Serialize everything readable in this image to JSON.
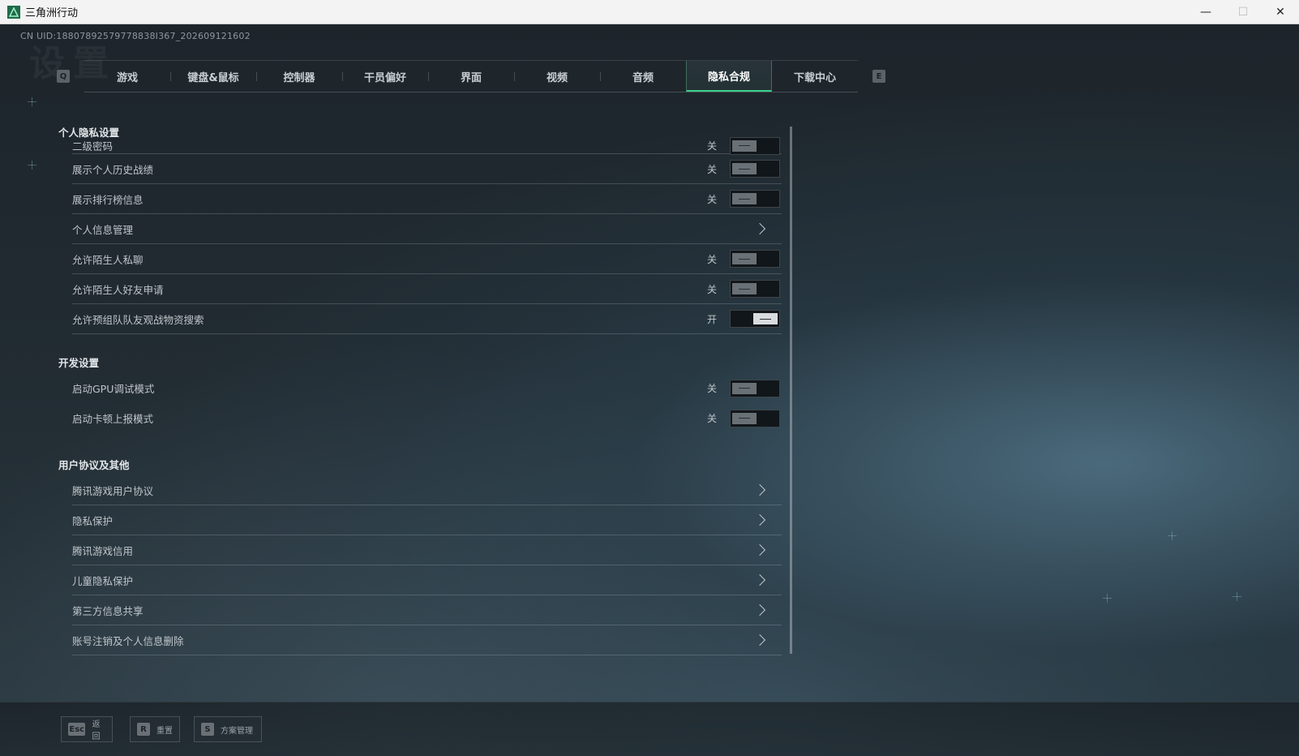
{
  "window": {
    "title": "三角洲行动",
    "minimize": "—",
    "maximize": "☐",
    "close": "✕"
  },
  "uid": "CN UID:18807892579778838I367_202609121602",
  "watermark": "设置",
  "tabs": {
    "prev_key": "Q",
    "next_key": "E",
    "items": [
      {
        "label": "游戏"
      },
      {
        "label": "键盘&鼠标"
      },
      {
        "label": "控制器"
      },
      {
        "label": "干员偏好"
      },
      {
        "label": "界面"
      },
      {
        "label": "视频"
      },
      {
        "label": "音频"
      },
      {
        "label": "隐私合规",
        "active": true
      },
      {
        "label": "下载中心"
      }
    ]
  },
  "sections": {
    "personal": {
      "title": "个人隐私设置",
      "rows": [
        {
          "label": "二级密码",
          "state": "关",
          "kind": "toggle",
          "on": false
        },
        {
          "label": "展示个人历史战绩",
          "state": "关",
          "kind": "toggle",
          "on": false
        },
        {
          "label": "展示排行榜信息",
          "state": "关",
          "kind": "toggle",
          "on": false
        },
        {
          "label": "个人信息管理",
          "kind": "link"
        },
        {
          "label": "允许陌生人私聊",
          "state": "关",
          "kind": "toggle",
          "on": false
        },
        {
          "label": "允许陌生人好友申请",
          "state": "关",
          "kind": "toggle",
          "on": false
        },
        {
          "label": "允许预组队队友观战物资搜索",
          "state": "开",
          "kind": "toggle",
          "on": true
        }
      ]
    },
    "dev": {
      "title": "开发设置",
      "rows": [
        {
          "label": "启动GPU调试模式",
          "state": "关",
          "kind": "toggle",
          "on": false
        },
        {
          "label": "启动卡顿上报模式",
          "state": "关",
          "kind": "toggle",
          "on": false
        }
      ]
    },
    "agreements": {
      "title": "用户协议及其他",
      "rows": [
        {
          "label": "腾讯游戏用户协议",
          "kind": "link"
        },
        {
          "label": "隐私保护",
          "kind": "link"
        },
        {
          "label": "腾讯游戏信用",
          "kind": "link"
        },
        {
          "label": "儿童隐私保护",
          "kind": "link"
        },
        {
          "label": "第三方信息共享",
          "kind": "link"
        },
        {
          "label": "账号注销及个人信息删除",
          "kind": "link"
        }
      ]
    }
  },
  "bottom": {
    "back": {
      "key": "Esc",
      "label": "返回"
    },
    "reset": {
      "key": "R",
      "label": "重置"
    },
    "plan": {
      "key": "S",
      "label": "方案管理"
    }
  },
  "colors": {
    "accent": "#38d08a",
    "background": "#1b2228"
  }
}
